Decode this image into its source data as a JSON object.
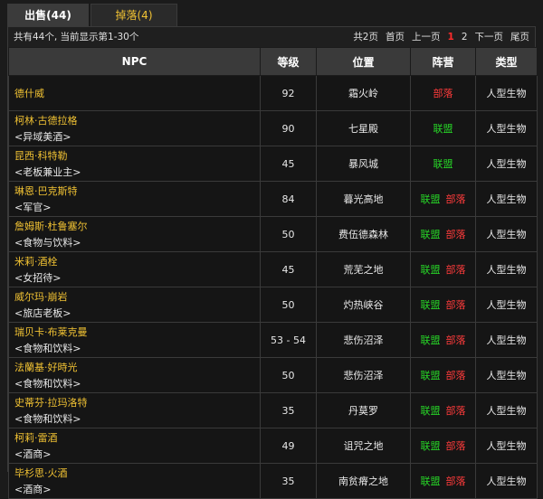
{
  "tabs": [
    {
      "label": "出售(44)",
      "active": true
    },
    {
      "label": "掉落(4)",
      "active": false
    }
  ],
  "info": "共有44个, 当前显示第1-30个",
  "pager": {
    "total": "共2页",
    "first": "首页",
    "prev": "上一页",
    "current": "1",
    "page2": "2",
    "next": "下一页",
    "last": "尾页"
  },
  "columns": {
    "npc": "NPC",
    "level": "等级",
    "location": "位置",
    "faction": "阵营",
    "type": "类型"
  },
  "faction_labels": {
    "alliance": "联盟",
    "horde": "部落"
  },
  "colors": {
    "alliance": "#27d627",
    "horde": "#ff3b3b",
    "npc_name": "#f1c233",
    "current_page": "#ff2b2b"
  },
  "rows": [
    {
      "name": "德什威",
      "title": "",
      "level": "92",
      "location": "霜火岭",
      "faction": "部落",
      "type": "人型生物"
    },
    {
      "name": "柯林·古德拉格",
      "title": "<异域美酒>",
      "level": "90",
      "location": "七星殿",
      "faction": "联盟",
      "type": "人型生物"
    },
    {
      "name": "昆西·科特勒",
      "title": "<老板兼业主>",
      "level": "45",
      "location": "暴风城",
      "faction": "联盟",
      "type": "人型生物"
    },
    {
      "name": "琳恩·巴克斯特",
      "title": "<军官>",
      "level": "84",
      "location": "暮光高地",
      "faction": "联盟 部落",
      "type": "人型生物"
    },
    {
      "name": "詹姆斯·杜鲁塞尔",
      "title": "<食物与饮料>",
      "level": "50",
      "location": "费伍德森林",
      "faction": "联盟 部落",
      "type": "人型生物"
    },
    {
      "name": "米莉·酒栓",
      "title": "<女招待>",
      "level": "45",
      "location": "荒芜之地",
      "faction": "联盟 部落",
      "type": "人型生物"
    },
    {
      "name": "威尔玛·崩岩",
      "title": "<旅店老板>",
      "level": "50",
      "location": "灼热峡谷",
      "faction": "联盟 部落",
      "type": "人型生物"
    },
    {
      "name": "瑞贝卡·布莱克曼",
      "title": "<食物和饮料>",
      "level": "53 - 54",
      "location": "悲伤沼泽",
      "faction": "联盟 部落",
      "type": "人型生物"
    },
    {
      "name": "法蘭基·好時光",
      "title": "<食物和饮料>",
      "level": "50",
      "location": "悲伤沼泽",
      "faction": "联盟 部落",
      "type": "人型生物"
    },
    {
      "name": "史蒂芬·拉玛洛特",
      "title": "<食物和饮料>",
      "level": "35",
      "location": "丹莫罗",
      "faction": "联盟 部落",
      "type": "人型生物"
    },
    {
      "name": "柯莉·雷酒",
      "title": "<酒商>",
      "level": "49",
      "location": "诅咒之地",
      "faction": "联盟 部落",
      "type": "人型生物"
    },
    {
      "name": "毕杉思·火酒",
      "title": "<酒商>",
      "level": "35",
      "location": "南贫瘠之地",
      "faction": "联盟 部落",
      "type": "人型生物"
    }
  ]
}
